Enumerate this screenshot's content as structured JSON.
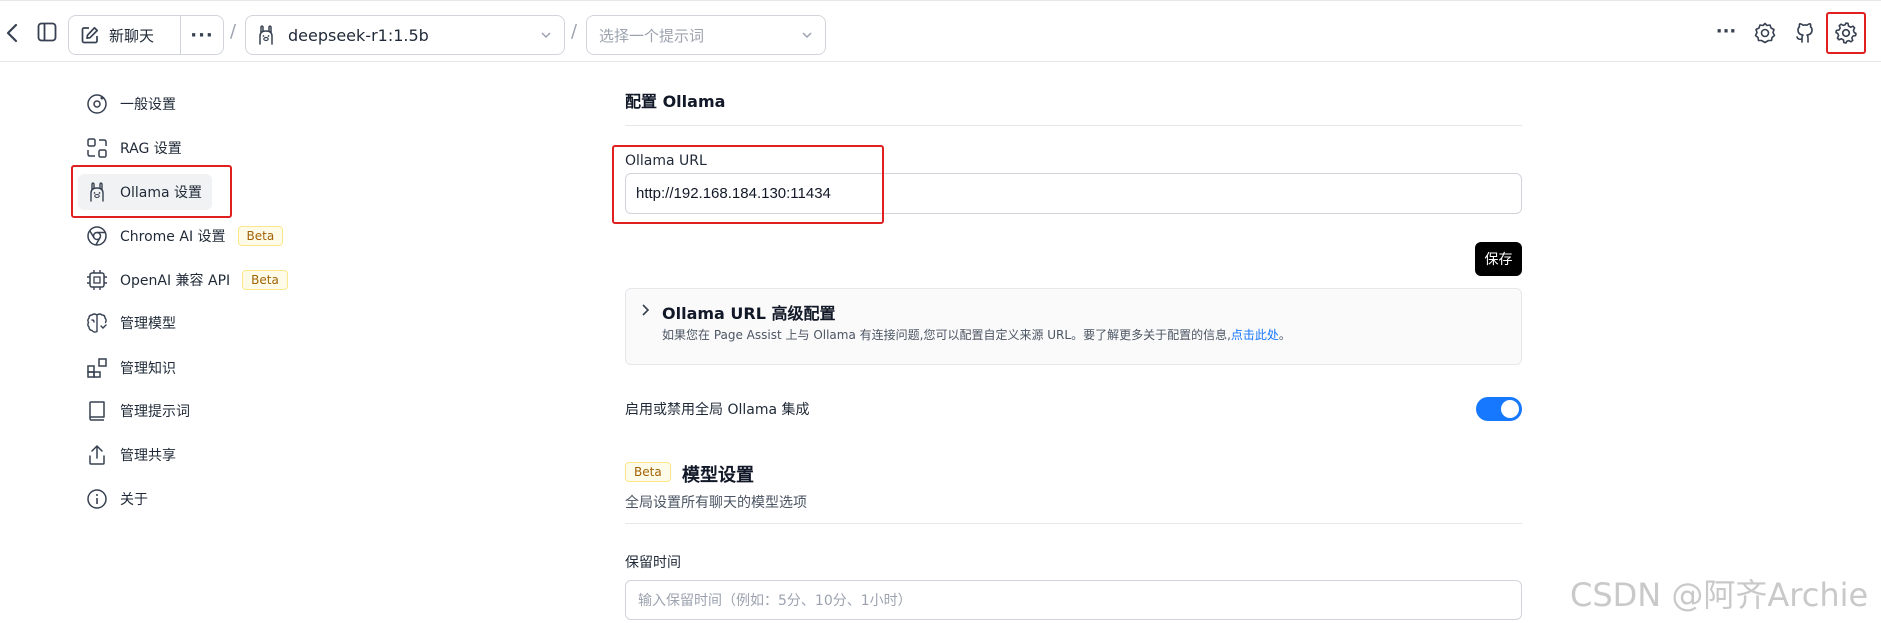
{
  "topbar": {
    "new_chat_label": "新聊天",
    "more_label": "···",
    "separator": "/",
    "model_name": "deepseek-r1:1.5b",
    "prompt_placeholder": "选择一个提示词",
    "right_more_label": "···",
    "icons": [
      "back-icon",
      "sidebar-toggle-icon",
      "edit-icon",
      "ollama-icon",
      "chevron-down-icon",
      "ollama-settings-icon",
      "github-icon",
      "settings-gear-icon"
    ]
  },
  "nav": {
    "items": [
      {
        "label": "一般设置",
        "icon": "general-settings-icon"
      },
      {
        "label": "RAG 设置",
        "icon": "rag-icon"
      },
      {
        "label": "Ollama 设置",
        "icon": "ollama-icon",
        "active": true
      },
      {
        "label": "Chrome AI 设置",
        "icon": "chrome-icon",
        "badge": "Beta"
      },
      {
        "label": "OpenAI 兼容 API",
        "icon": "cpu-icon",
        "badge": "Beta"
      },
      {
        "label": "管理模型",
        "icon": "brain-icon"
      },
      {
        "label": "管理知识",
        "icon": "blocks-icon"
      },
      {
        "label": "管理提示词",
        "icon": "book-icon"
      },
      {
        "label": "管理共享",
        "icon": "share-icon"
      },
      {
        "label": "关于",
        "icon": "info-icon"
      }
    ]
  },
  "main": {
    "title": "配置 Ollama",
    "url_label": "Ollama URL",
    "url_value": "http://192.168.184.130:11434",
    "save_label": "保存",
    "advanced": {
      "title": "Ollama URL 高级配置",
      "desc_before": "如果您在 Page Assist 上与 Ollama 有连接问题,您可以配置自定义来源 URL。要了解更多关于配置的信息,",
      "link": "点击此处",
      "desc_after": "。"
    },
    "toggle_label": "启用或禁用全局 Ollama 集成",
    "toggle_on": true,
    "model_settings": {
      "badge": "Beta",
      "title": "模型设置",
      "subtitle": "全局设置所有聊天的模型选项"
    },
    "keep_label": "保留时间",
    "keep_placeholder": "输入保留时间（例如：5分、10分、1小时）"
  },
  "watermark": "CSDN @阿齐Archie",
  "colors": {
    "accent": "#1677ff",
    "highlight": "#e02020",
    "save_bg": "#000000"
  }
}
